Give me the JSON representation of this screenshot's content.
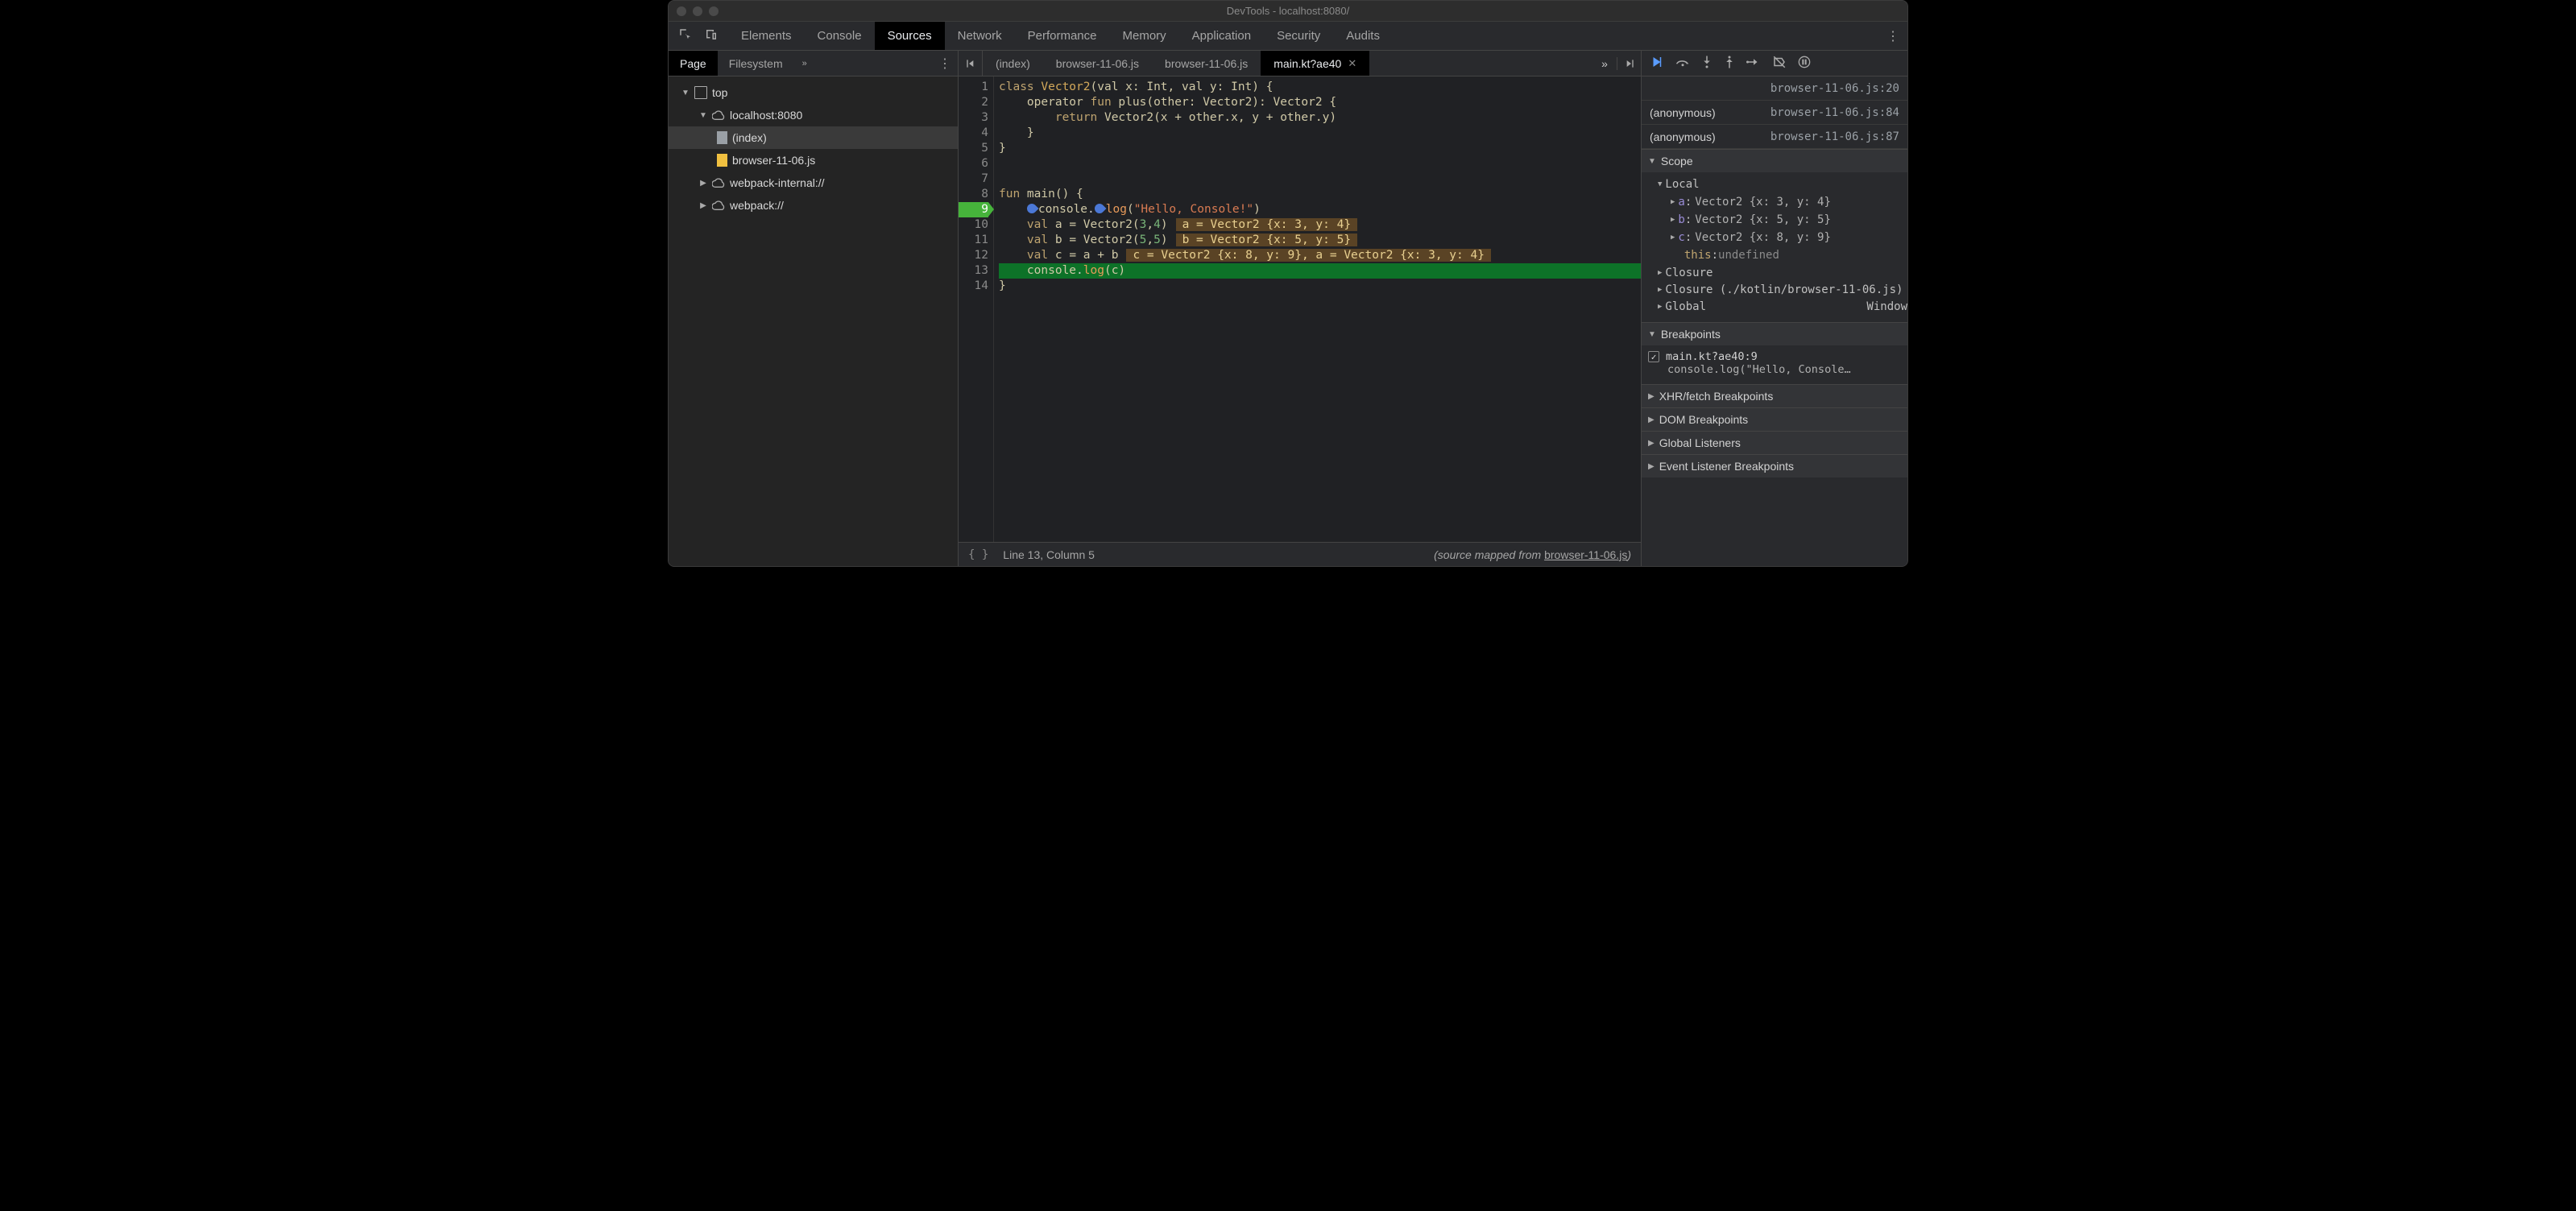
{
  "window": {
    "title": "DevTools - localhost:8080/"
  },
  "toolbar": {
    "tabs": [
      "Elements",
      "Console",
      "Sources",
      "Network",
      "Performance",
      "Memory",
      "Application",
      "Security",
      "Audits"
    ],
    "active": "Sources"
  },
  "sidebar": {
    "navtabs": [
      "Page",
      "Filesystem"
    ],
    "navtabs_active": "Page",
    "tree": {
      "top": "top",
      "host": "localhost:8080",
      "files": [
        "(index)",
        "browser-11-06.js"
      ],
      "webpack_internal": "webpack-internal://",
      "webpack": "webpack://"
    }
  },
  "filetabs": {
    "tabs": [
      "(index)",
      "browser-11-06.js",
      "browser-11-06.js",
      "main.kt?ae40"
    ],
    "active": "main.kt?ae40"
  },
  "code": {
    "total_lines": 14,
    "breakpoint_line": 9,
    "highlight_line": 13,
    "lines": {
      "l1_kw_class": "class",
      "l1_ty": "Vector2",
      "l1_rest": "(val x: Int, val y: Int) {",
      "l2_pre": "    operator ",
      "l2_kw_fun": "fun",
      "l2_rest": " plus(other: Vector2): Vector2 {",
      "l3_pre": "        ",
      "l3_kw": "return",
      "l3_rest": " Vector2(x + other.x, y + other.y)",
      "l4": "    }",
      "l5": "}",
      "l6": "",
      "l7": "",
      "l8_kw": "fun",
      "l8_rest": " main() {",
      "l9_pre": "    ",
      "l9_console": "console",
      "l9_dot": ".",
      "l9_log": "log",
      "l9_par_open": "(",
      "l9_str": "\"Hello, Console!\"",
      "l9_par_close": ")",
      "l10_pre": "    ",
      "l10_kw": "val",
      "l10_rest": " a = Vector2(",
      "l10_n1": "3",
      "l10_c": ",",
      "l10_n2": "4",
      "l10_close": ")",
      "l10_inlay": "a = Vector2 {x: 3, y: 4}",
      "l11_pre": "    ",
      "l11_kw": "val",
      "l11_rest": " b = Vector2(",
      "l11_n1": "5",
      "l11_c": ",",
      "l11_n2": "5",
      "l11_close": ")",
      "l11_inlay": "b = Vector2 {x: 5, y: 5}",
      "l12_pre": "    ",
      "l12_kw": "val",
      "l12_rest": " c = a + b",
      "l12_inlay": "c = Vector2 {x: 8, y: 9}, a = Vector2 {x: 3, y: 4}",
      "l13_pre": "    ",
      "l13_console": "console",
      "l13_dot": ".",
      "l13_log": "log",
      "l13_rest": "(c)",
      "l14": "}"
    }
  },
  "status": {
    "pos": "Line 13, Column 5",
    "mapped_prefix": "(source mapped from ",
    "mapped_link": "browser-11-06.js",
    "mapped_suffix": ")"
  },
  "debugger": {
    "stack": [
      {
        "loc": "browser-11-06.js:20"
      },
      {
        "fn": "(anonymous)",
        "loc": "browser-11-06.js:84"
      },
      {
        "fn": "(anonymous)",
        "loc": "browser-11-06.js:87"
      }
    ],
    "scope": {
      "title": "Scope",
      "local": "Local",
      "vars": [
        {
          "name": "a",
          "val": "Vector2 {x: 3, y: 4}"
        },
        {
          "name": "b",
          "val": "Vector2 {x: 5, y: 5}"
        },
        {
          "name": "c",
          "val": "Vector2 {x: 8, y: 9}"
        }
      ],
      "this_label": "this",
      "this_val": "undefined",
      "closure": "Closure",
      "closure2": "Closure (./kotlin/browser-11-06.js)",
      "global": "Global",
      "global_val": "Window"
    },
    "breakpoints": {
      "title": "Breakpoints",
      "bp1_label": "main.kt?ae40:9",
      "bp1_line": "console.log(\"Hello, Console…"
    },
    "sections": {
      "xhr": "XHR/fetch Breakpoints",
      "dom": "DOM Breakpoints",
      "global": "Global Listeners",
      "evt": "Event Listener Breakpoints"
    }
  }
}
